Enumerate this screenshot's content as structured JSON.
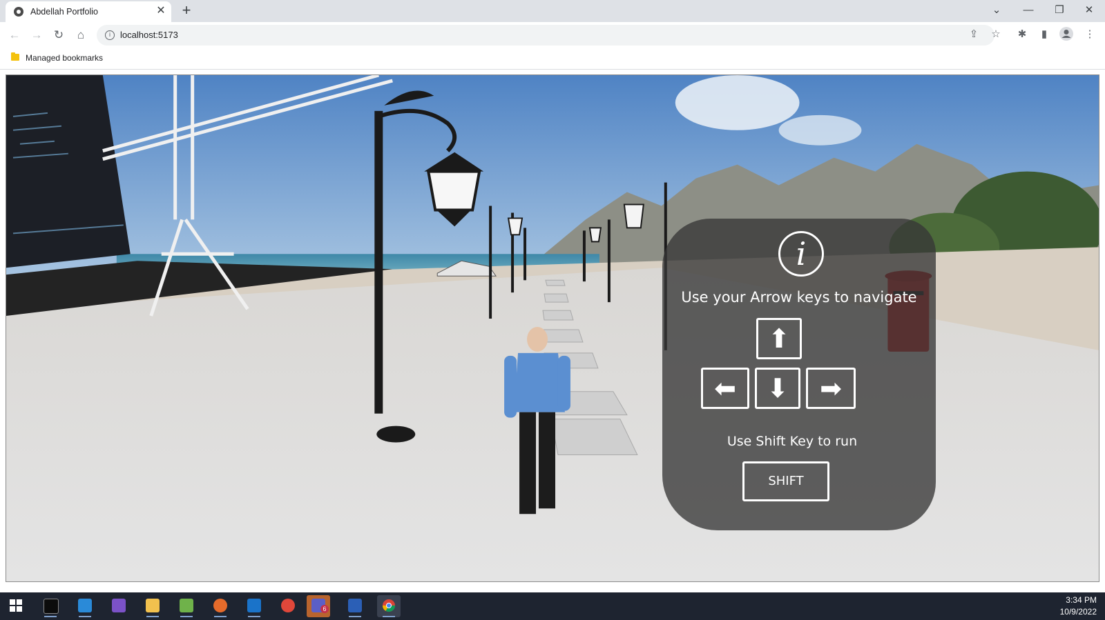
{
  "browser": {
    "tab": {
      "title": "Abdellah Portfolio",
      "close_glyph": "✕",
      "favicon": "portfolio-favicon"
    },
    "new_tab_glyph": "+",
    "window_controls": {
      "tab_search": "⌄",
      "minimize": "—",
      "restore": "❐",
      "close": "✕"
    },
    "nav": {
      "back": "←",
      "forward": "→",
      "reload": "↻",
      "home": "⌂"
    },
    "address": {
      "url": "localhost:5173",
      "info_glyph": "i"
    },
    "toolbar_icons": {
      "share": "⇪",
      "bookmark_star": "☆",
      "extensions": "✱",
      "side_panel": "▮",
      "profile": "●",
      "menu": "⋮"
    },
    "bookmarks_bar": {
      "folder_label": "Managed bookmarks"
    }
  },
  "page": {
    "overlay": {
      "info_glyph": "i",
      "navigate_text": "Use your Arrow keys to navigate",
      "keys": {
        "up": "⬆",
        "left": "⬅",
        "down": "⬇",
        "right": "➡"
      },
      "run_text": "Use Shift Key to run",
      "shift_label": "SHIFT"
    }
  },
  "taskbar": {
    "apps": [
      "windows-start",
      "terminal",
      "vscode",
      "visual-studio",
      "file-explorer",
      "task-manager",
      "firefox",
      "outlook",
      "app-red",
      "teams",
      "word",
      "chrome"
    ],
    "teams_badge": "6",
    "time": "3:34 PM",
    "date": "10/9/2022"
  },
  "colors": {
    "tabbar": "#dee1e6",
    "overlay": "#373737",
    "taskbar": "#1e2430"
  }
}
